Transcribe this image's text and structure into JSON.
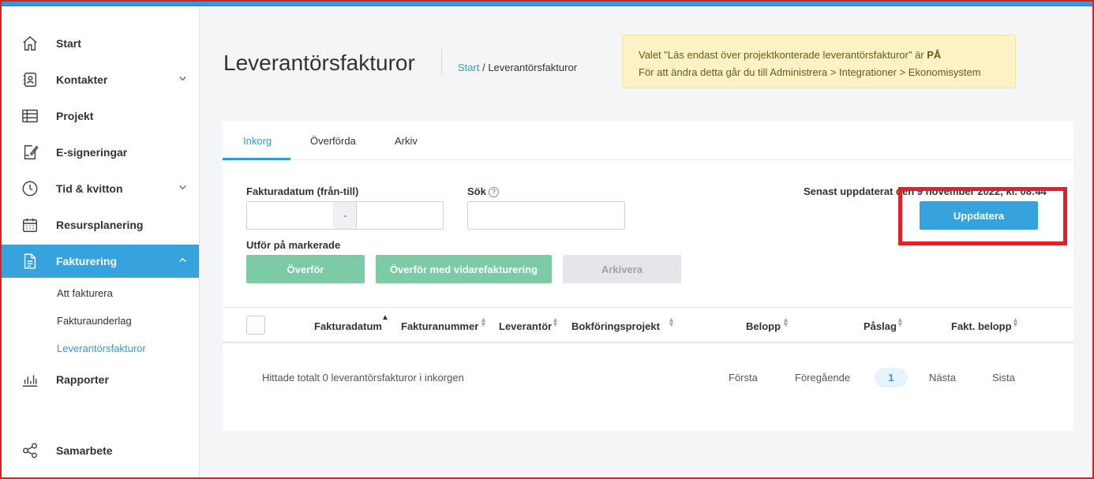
{
  "sidebar": {
    "items": [
      {
        "label": "Start",
        "icon": "home-icon"
      },
      {
        "label": "Kontakter",
        "icon": "contacts-icon",
        "expandable": true
      },
      {
        "label": "Projekt",
        "icon": "table-icon"
      },
      {
        "label": "E-signeringar",
        "icon": "signature-icon"
      },
      {
        "label": "Tid & kvitton",
        "icon": "clock-icon",
        "expandable": true
      },
      {
        "label": "Resursplanering",
        "icon": "calendar-icon"
      },
      {
        "label": "Fakturering",
        "icon": "document-icon",
        "expanded": true,
        "active": true
      },
      {
        "label": "Rapporter",
        "icon": "bar-chart-icon"
      },
      {
        "label": "Samarbete",
        "icon": "share-icon"
      }
    ],
    "subitems": [
      {
        "label": "Att fakturera"
      },
      {
        "label": "Fakturaunderlag"
      },
      {
        "label": "Leverantörsfakturor",
        "current": true
      }
    ]
  },
  "header": {
    "title": "Leverantörsfakturor",
    "breadcrumb_root": "Start",
    "breadcrumb_sep": " / ",
    "breadcrumb_current": "Leverantörsfakturor"
  },
  "notice": {
    "line1_prefix": "Valet \"Läs endast över projektkonterade leverantörsfakturor\" är ",
    "line1_status": "PÅ",
    "line2": "För att ändra detta går du till Administrera > Integrationer > Ekonomisystem"
  },
  "tabs": [
    {
      "label": "Inkorg",
      "active": true
    },
    {
      "label": "Överförda"
    },
    {
      "label": "Arkiv"
    }
  ],
  "filters": {
    "date_label": "Fakturadatum (från-till)",
    "date_from": "",
    "date_to": "",
    "date_separator": "-",
    "search_label": "Sök",
    "search_help": "?",
    "search_value": ""
  },
  "actions": {
    "label": "Utför på markerade",
    "transfer": "Överför",
    "transfer_rebill": "Överför med vidarefakturering",
    "archive": "Arkivera"
  },
  "update": {
    "last_updated_text": "Senast uppdaterat den 9 november 2022, kl. 08:44",
    "button_label": "Uppdatera"
  },
  "table": {
    "columns": [
      "Fakturadatum",
      "Fakturanummer",
      "Leverantör",
      "Bokföringsprojekt",
      "Belopp",
      "Påslag",
      "Fakt. belopp"
    ],
    "rows": []
  },
  "footer": {
    "summary": "Hittade totalt 0 leverantörsfakturor i inkorgen",
    "first": "Första",
    "previous": "Föregående",
    "current_page": "1",
    "next": "Nästa",
    "last": "Sista"
  },
  "colors": {
    "accent": "#36a2de",
    "success": "#7ccaa6",
    "notice_bg": "#fdf2c6",
    "highlight": "#e0202a"
  }
}
